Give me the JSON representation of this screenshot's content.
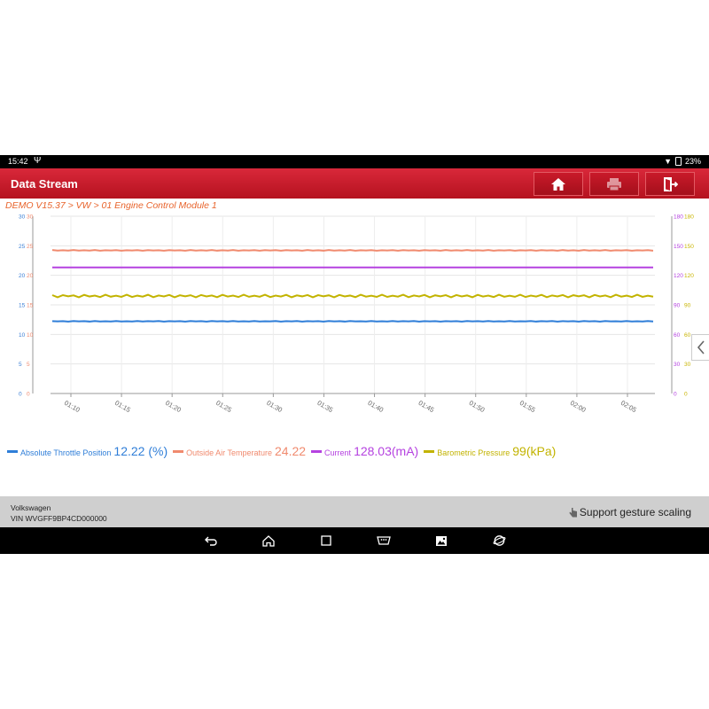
{
  "status_bar": {
    "time": "15:42",
    "battery": "23%"
  },
  "app_bar": {
    "title": "Data Stream",
    "buttons": [
      {
        "name": "home",
        "icon": "home-icon"
      },
      {
        "name": "print",
        "icon": "print-icon"
      },
      {
        "name": "exit",
        "icon": "exit-icon"
      }
    ]
  },
  "breadcrumb": "DEMO V15.37 > VW > 01 Engine Control Module 1",
  "chart_data": {
    "type": "line",
    "x": [
      "01:10",
      "01:15",
      "01:20",
      "01:25",
      "01:30",
      "01:35",
      "01:40",
      "01:45",
      "01:50",
      "01:55",
      "02:00",
      "02:05"
    ],
    "axes": {
      "left_outer": {
        "ticks": [
          "0",
          "5",
          "10",
          "15",
          "20",
          "25",
          "30"
        ],
        "ylim": [
          0,
          30
        ],
        "color": "#3a7fd5"
      },
      "left_inner": {
        "ticks": [
          "0",
          "5",
          "10",
          "15",
          "20",
          "25",
          "30"
        ],
        "ylim": [
          0,
          30
        ],
        "color": "#f08a6e"
      },
      "right_inner": {
        "ticks": [
          "0",
          "30",
          "60",
          "90",
          "120",
          "150",
          "180"
        ],
        "ylim": [
          0,
          180
        ],
        "color": "#b542e0"
      },
      "right_outer": {
        "ticks": [
          "0",
          "30",
          "60",
          "90",
          "120",
          "150",
          "180"
        ],
        "ylim": [
          0,
          180
        ],
        "color": "#c8b400"
      }
    },
    "grid": true,
    "series": [
      {
        "name": "Absolute Throttle Position",
        "value": 12.22,
        "axis": "left_outer",
        "color": "#2f7ed8",
        "jitter": 0.05
      },
      {
        "name": "Outside Air Temperature",
        "value": 24.22,
        "axis": "left_inner",
        "color": "#f08a6e",
        "jitter": 0.06
      },
      {
        "name": "Current",
        "value": 128.03,
        "axis": "right_inner",
        "color": "#b542e0",
        "jitter": 0
      },
      {
        "name": "Barometric Pressure",
        "value": 99,
        "axis": "right_outer",
        "color": "#c2b300",
        "jitter": 1.4
      }
    ]
  },
  "legend": [
    {
      "name": "Absolute Throttle Position",
      "value": "12.22 (%)",
      "color": "#2f7ed8"
    },
    {
      "name": "Outside Air Temperature",
      "value": "24.22",
      "color": "#f08a6e"
    },
    {
      "name": "Current",
      "value": "128.03(mA)",
      "color": "#b542e0"
    },
    {
      "name": "Barometric Pressure",
      "value": "99(kPa)",
      "color": "#c2b300"
    }
  ],
  "info_bar": {
    "make": "Volkswagen",
    "vin": "VIN WVGFF9BP4CD000000",
    "gesture_hint": "Support gesture scaling"
  }
}
